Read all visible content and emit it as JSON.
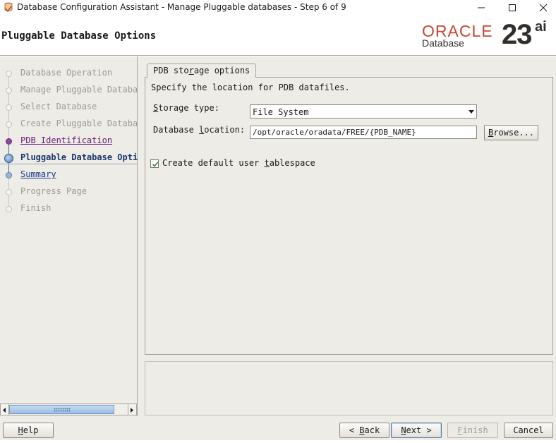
{
  "window": {
    "title": "Database Configuration Assistant - Manage Pluggable databases - Step 6 of 9"
  },
  "header": {
    "page_title": "Pluggable Database Options",
    "brand": {
      "oracle": "ORACLE",
      "product": "Database",
      "version": "23",
      "version_suffix": "ai",
      "color": "#c74634"
    }
  },
  "nav": {
    "items": [
      {
        "label": "Database Operation",
        "state": "done"
      },
      {
        "label": "Manage Pluggable Database",
        "state": "done"
      },
      {
        "label": "Select Database",
        "state": "done"
      },
      {
        "label": "Create Pluggable Database",
        "state": "done"
      },
      {
        "label": "PDB Identification",
        "state": "visited"
      },
      {
        "label": "Pluggable Database Options",
        "state": "current"
      },
      {
        "label": "Summary",
        "state": "future-link"
      },
      {
        "label": "Progress Page",
        "state": "future"
      },
      {
        "label": "Finish",
        "state": "future"
      }
    ]
  },
  "tab": {
    "label_pre": "PDB sto",
    "label_mn": "r",
    "label_post": "age options"
  },
  "content": {
    "description": "Specify the location for PDB datafiles.",
    "storage_type": {
      "label_mn": "S",
      "label_rest": "torage type:",
      "value": "File System"
    },
    "db_location": {
      "label_pre": "Database ",
      "label_mn": "l",
      "label_post": "ocation:",
      "value": "/opt/oracle/oradata/FREE/{PDB_NAME}",
      "browse_mn": "B",
      "browse_rest": "rowse..."
    },
    "default_tablespace": {
      "checked": true,
      "label_pre": "Create default user ",
      "label_mn": "t",
      "label_post": "ablespace"
    }
  },
  "buttons": {
    "help_mn": "H",
    "help_rest": "elp",
    "back_pre": "< ",
    "back_mn": "B",
    "back_post": "ack",
    "next_mn": "N",
    "next_post": "ext >",
    "finish_mn": "F",
    "finish_post": "inish",
    "cancel": "Cancel"
  }
}
